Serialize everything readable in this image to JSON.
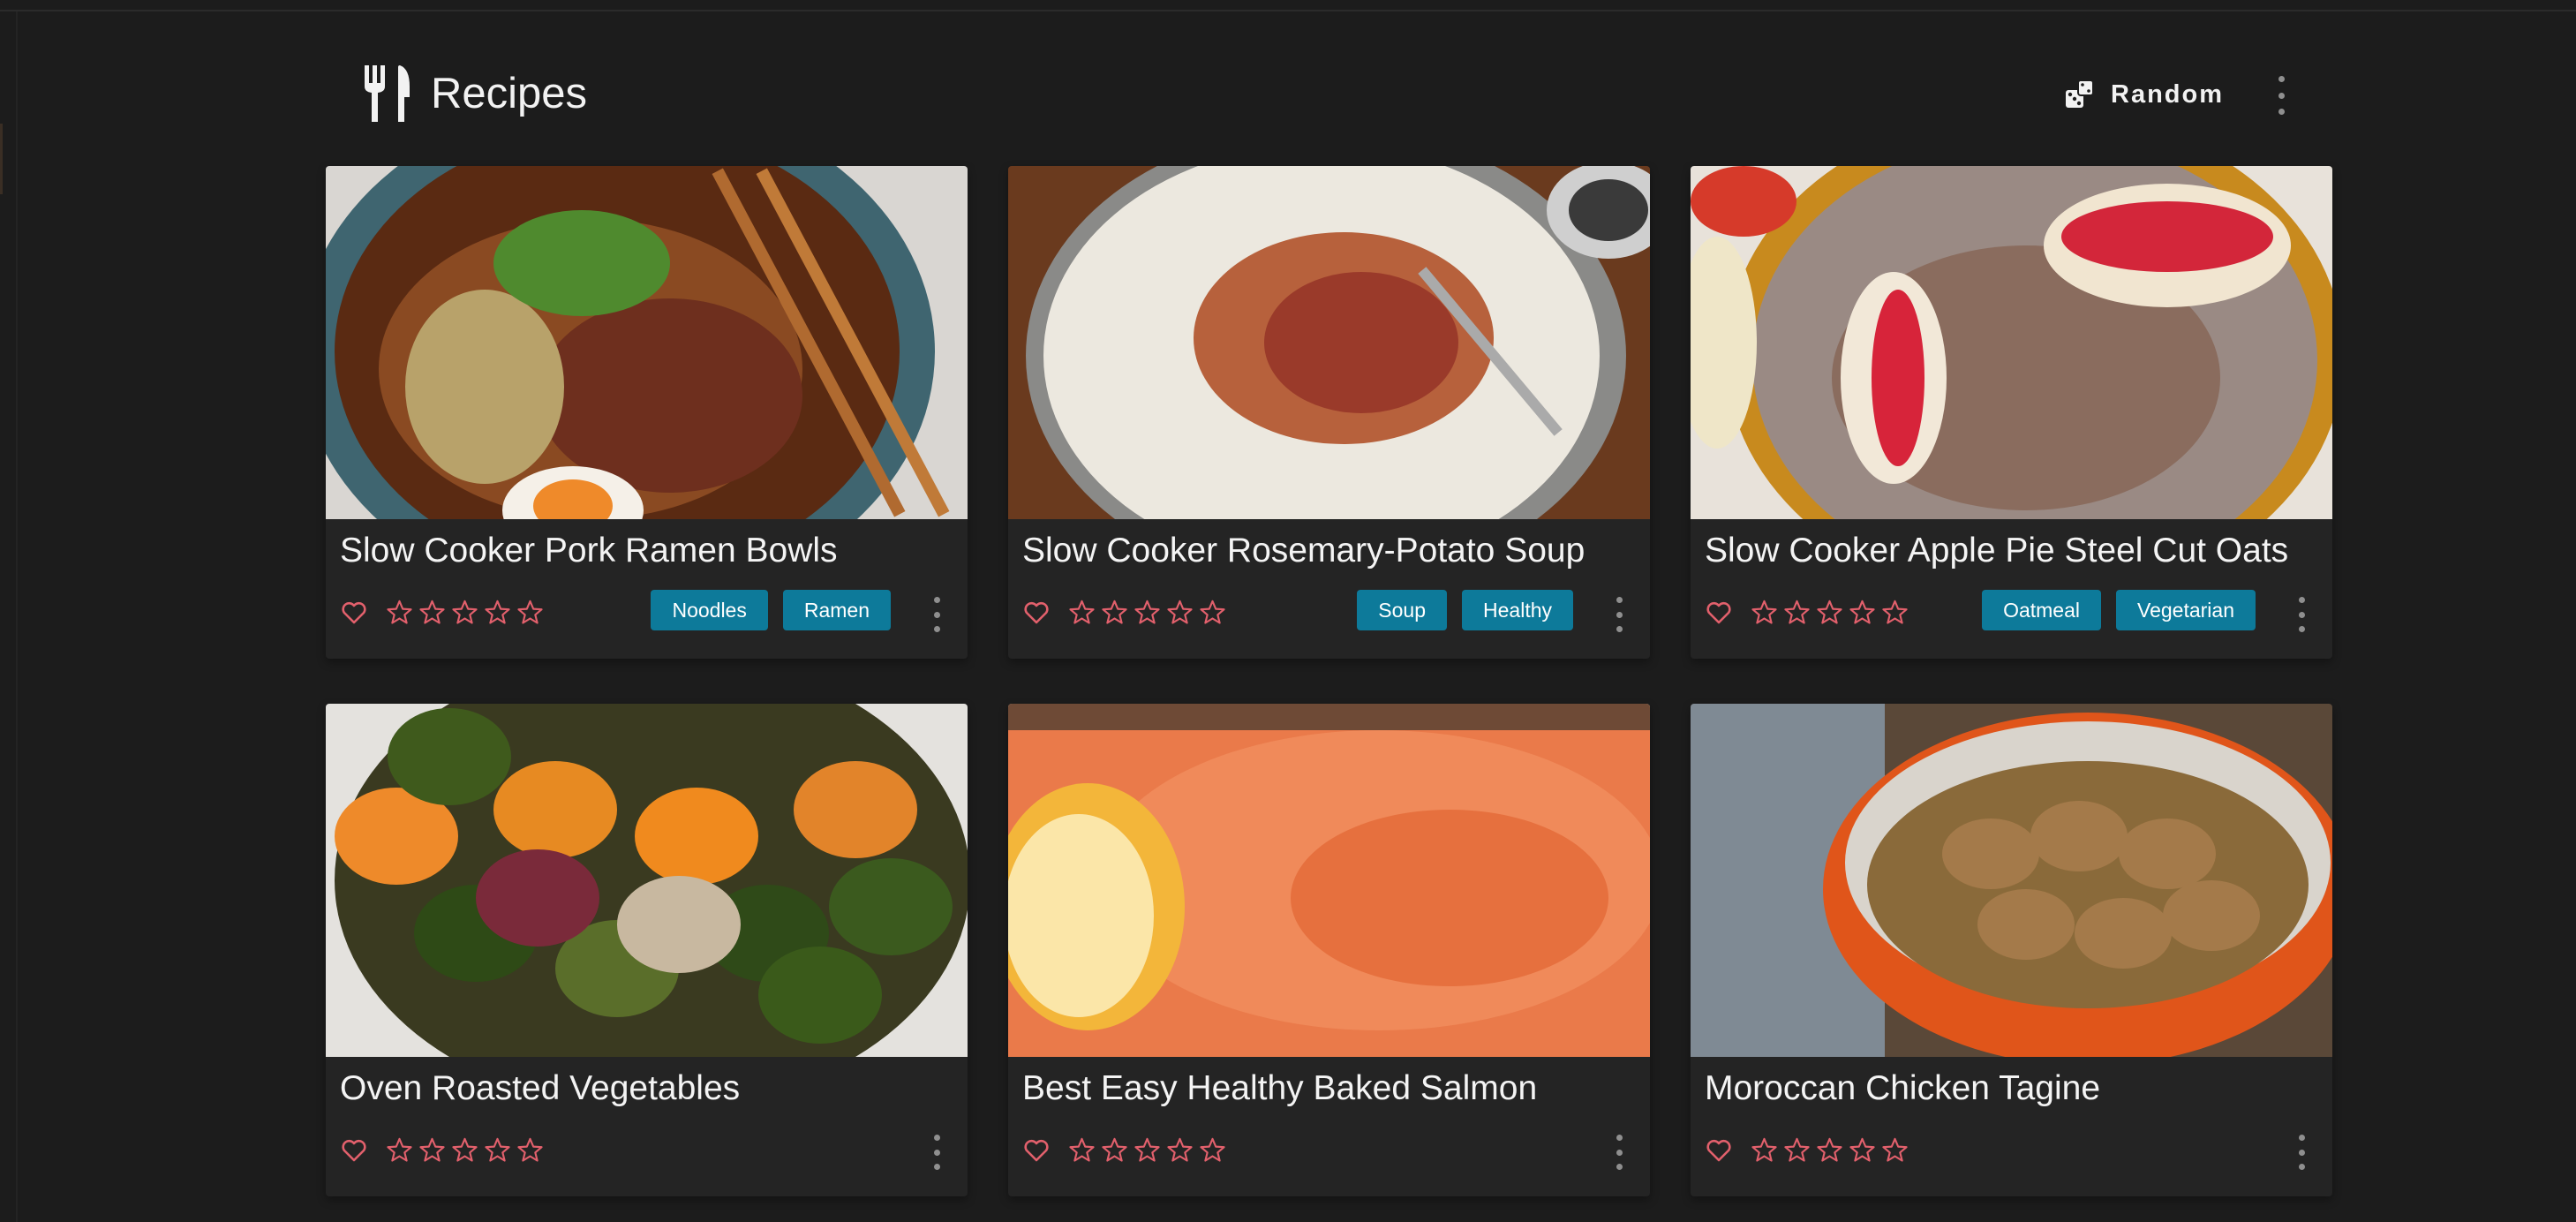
{
  "header": {
    "title": "Recipes",
    "random_label": "Random",
    "logo_icon": "silverware-fork-knife-icon",
    "random_icon": "dice-icon",
    "menu_icon": "vertical-dots-icon"
  },
  "colors": {
    "background": "#1c1c1c",
    "card": "#242424",
    "tag": "#0d7a9a",
    "heart": "#e2606c",
    "star": "#e2606c"
  },
  "recipes": [
    {
      "title": "Slow Cooker Pork Ramen Bowls",
      "tags": [
        "Noodles",
        "Ramen"
      ],
      "rating": 0,
      "favorite": false,
      "image": "ramen-bowl-photo"
    },
    {
      "title": "Slow Cooker Rosemary-Potato Soup",
      "tags": [
        "Soup",
        "Healthy"
      ],
      "rating": 0,
      "favorite": false,
      "image": "potato-soup-photo"
    },
    {
      "title": "Slow Cooker Apple Pie Steel Cut Oats",
      "tags": [
        "Oatmeal",
        "Vegetarian"
      ],
      "rating": 0,
      "favorite": false,
      "image": "apple-oats-photo"
    },
    {
      "title": "Oven Roasted Vegetables",
      "tags": [],
      "rating": 0,
      "favorite": false,
      "image": "roasted-vegetables-photo"
    },
    {
      "title": "Best Easy Healthy Baked Salmon",
      "tags": [],
      "rating": 0,
      "favorite": false,
      "image": "baked-salmon-photo"
    },
    {
      "title": "Moroccan Chicken Tagine",
      "tags": [],
      "rating": 0,
      "favorite": false,
      "image": "chicken-tagine-photo"
    }
  ]
}
